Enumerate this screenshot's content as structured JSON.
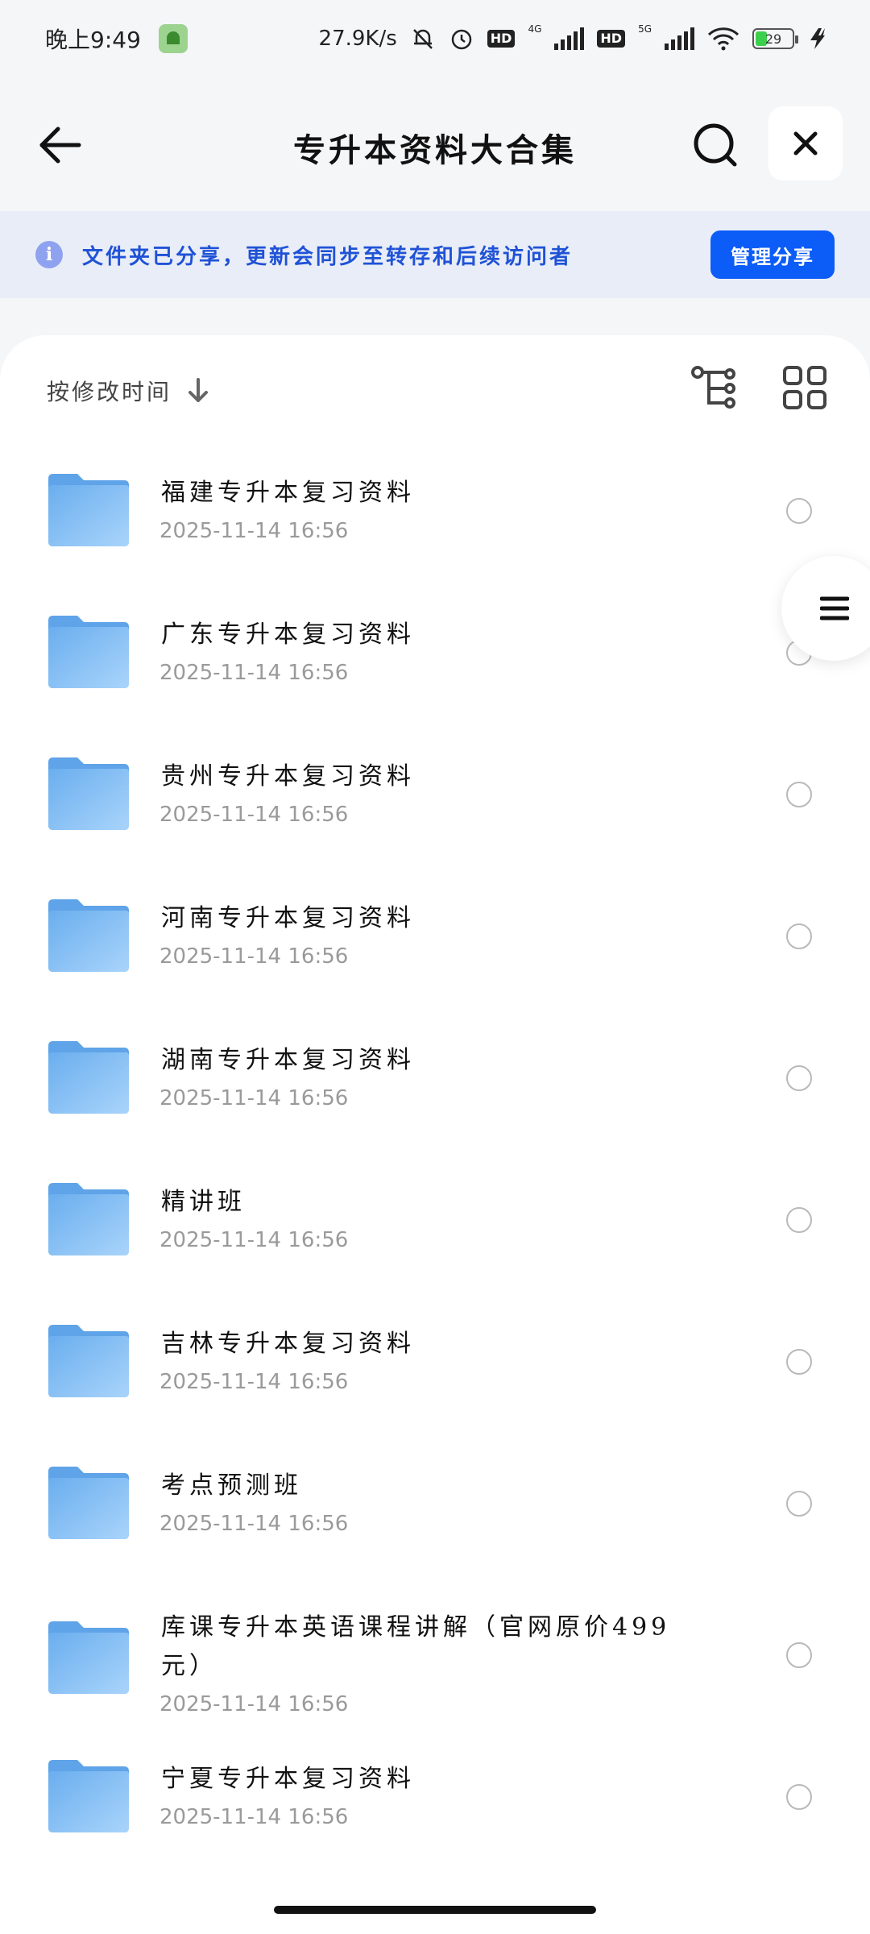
{
  "status_bar": {
    "time": "晚上9:49",
    "net_speed": "27.9K/s",
    "hd1": "HD",
    "gen1": "4G",
    "hd2": "HD",
    "gen2": "5G",
    "battery": "29"
  },
  "header": {
    "title": "专升本资料大合集"
  },
  "share_banner": {
    "text": "文件夹已分享，更新会同步至转存和后续访问者",
    "manage_label": "管理分享"
  },
  "sort": {
    "label": "按修改时间"
  },
  "colors": {
    "accent": "#0c5cf7",
    "banner_text": "#1f52d6",
    "banner_bg": "#e9edf7",
    "folder": "#7db8f0"
  },
  "files": [
    {
      "name": "福建专升本复习资料",
      "date": "2025-11-14  16:56"
    },
    {
      "name": "广东专升本复习资料",
      "date": "2025-11-14  16:56"
    },
    {
      "name": "贵州专升本复习资料",
      "date": "2025-11-14  16:56"
    },
    {
      "name": "河南专升本复习资料",
      "date": "2025-11-14  16:56"
    },
    {
      "name": "湖南专升本复习资料",
      "date": "2025-11-14  16:56"
    },
    {
      "name": "精讲班",
      "date": "2025-11-14  16:56"
    },
    {
      "name": "吉林专升本复习资料",
      "date": "2025-11-14  16:56"
    },
    {
      "name": "考点预测班",
      "date": "2025-11-14  16:56"
    },
    {
      "name": "库课专升本英语课程讲解（官网原价499元）",
      "date": "2025-11-14  16:56"
    },
    {
      "name": "宁夏专升本复习资料",
      "date": "2025-11-14  16:56"
    }
  ]
}
